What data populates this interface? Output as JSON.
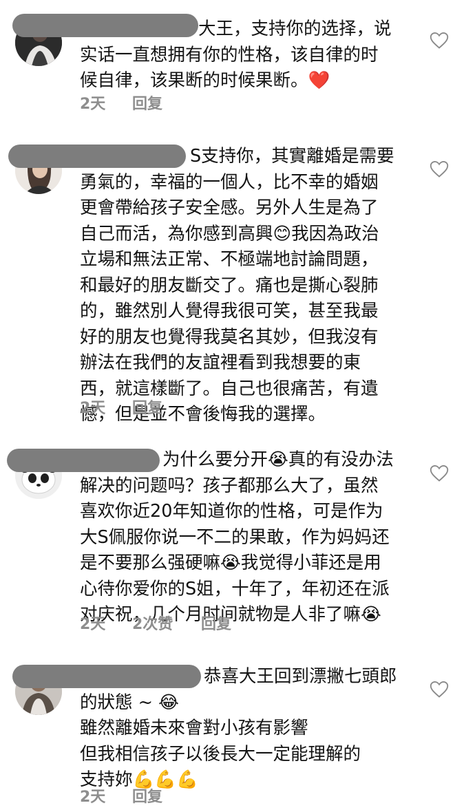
{
  "comments": [
    {
      "text": "大王，支持你的选择，说\n实话一直想拥有你的性格，该自律的时\n候自律，该果断的时候果断。❤️",
      "time": "2天",
      "likes": "",
      "reply": "回复",
      "avatar_icon": "user-avatar-icon",
      "like_icon": "heart-outline-icon"
    },
    {
      "text": "S支持你，其實離婚是需要\n勇氣的，幸福的一個人，比不幸的婚姻\n更會帶給孩子安全感。另外人生是為了\n自己而活，為你感到高興😊我因為政治\n立場和無法正常、不極端地討論問題，\n和最好的朋友斷交了。痛也是撕心裂肺\n的，雖然別人覺得我很可笑，甚至我最\n好的朋友也覺得我莫名其妙，但我沒有\n辦法在我們的友誼裡看到我想要的東\n西，就這樣斷了。自己也很痛苦，有遺\n憾，但是並不會後悔我的選擇。",
      "time": "2天",
      "likes": "",
      "reply": "回复",
      "avatar_icon": "user-avatar-icon",
      "like_icon": "heart-outline-icon"
    },
    {
      "text": "为什么要分开😭真的有没办法\n解决的问题吗？孩子都那么大了，虽然\n喜欢你近20年知道你的性格，可是作为\n大S佩服你说一不二的果敢，作为妈妈还\n是不要那么强硬嘛😭我觉得小菲还是用\n心待你爱你的S姐，十年了，年初还在派\n对庆祝，几个月时间就物是人非了嘛😭",
      "time": "2天",
      "likes": "2次赞",
      "reply": "回复",
      "avatar_icon": "panda-avatar-icon",
      "like_icon": "heart-outline-icon"
    },
    {
      "text": "恭喜大王回到漂撇七頭郎\n的狀態 ~ 😂\n雖然離婚未來會對小孩有影響\n但我相信孩子以後長大一定能理解的\n支持妳💪💪💪",
      "time": "2天",
      "likes": "",
      "reply": "回复",
      "avatar_icon": "user-avatar-icon",
      "like_icon": "heart-outline-icon"
    }
  ]
}
